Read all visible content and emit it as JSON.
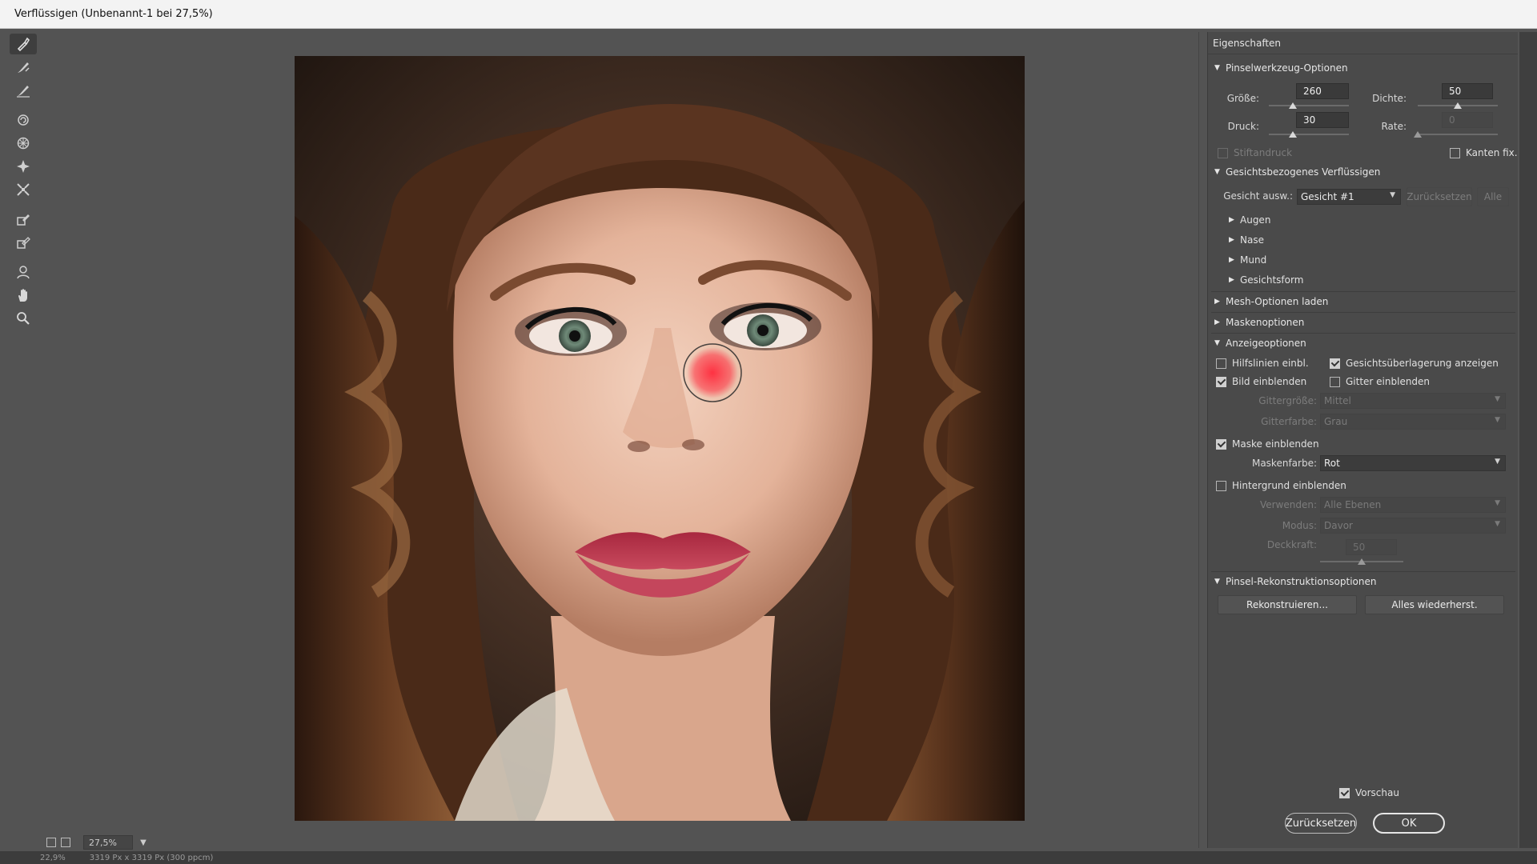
{
  "window": {
    "title": "Verflüssigen (Unbenannt-1 bei 27,5%)"
  },
  "toolbar": {
    "tools": [
      "forward-warp",
      "reconstruct",
      "smooth",
      "twirl",
      "pucker",
      "bloat",
      "push-left",
      "freeze-mask",
      "thaw-mask",
      "face",
      "hand",
      "zoom"
    ]
  },
  "canvas": {
    "zoom": "27,5%",
    "status_zoom": "22,9%",
    "status_doc": "3319 Px x 3319 Px (300 ppcm)"
  },
  "panel": {
    "title": "Eigenschaften",
    "brush": {
      "header": "Pinselwerkzeug-Optionen",
      "size_label": "Größe:",
      "size_value": "260",
      "size_pct": 0.3,
      "density_label": "Dichte:",
      "density_value": "50",
      "density_pct": 0.5,
      "pressure_label": "Druck:",
      "pressure_value": "30",
      "pressure_pct": 0.3,
      "rate_label": "Rate:",
      "rate_value": "0",
      "rate_pct": 0.0,
      "stylus_label": "Stiftandruck",
      "edges_label": "Kanten fix."
    },
    "face": {
      "header": "Gesichtsbezogenes Verflüssigen",
      "select_label": "Gesicht ausw.:",
      "select_value": "Gesicht #1",
      "reset_label": "Zurücksetzen",
      "all_label": "Alle",
      "items": [
        "Augen",
        "Nase",
        "Mund",
        "Gesichtsform"
      ]
    },
    "mesh": {
      "header": "Mesh-Optionen laden"
    },
    "mask": {
      "header": "Maskenoptionen"
    },
    "view": {
      "header": "Anzeigeoptionen",
      "guides_label": "Hilfslinien einbl.",
      "overlay_label": "Gesichtsüberlagerung anzeigen",
      "image_label": "Bild einblenden",
      "mesh_label": "Gitter einblenden",
      "mesh_size_label": "Gittergröße:",
      "mesh_size_value": "Mittel",
      "mesh_color_label": "Gitterfarbe:",
      "mesh_color_value": "Grau",
      "show_mask_label": "Maske einblenden",
      "mask_color_label": "Maskenfarbe:",
      "mask_color_value": "Rot",
      "backdrop_label": "Hintergrund einblenden",
      "use_label": "Verwenden:",
      "use_value": "Alle Ebenen",
      "mode_label": "Modus:",
      "mode_value": "Davor",
      "opacity_label": "Deckkraft:",
      "opacity_value": "50",
      "opacity_pct": 0.5
    },
    "recon": {
      "header": "Pinsel-Rekonstruktionsoptionen",
      "reconstruct_label": "Rekonstruieren...",
      "restore_label": "Alles wiederherst."
    },
    "preview_label": "Vorschau",
    "reset_button": "Zurücksetzen",
    "ok_button": "OK"
  },
  "colors": {
    "panel_bg": "#4a4a4a",
    "canvas_bg": "#535353",
    "mask_red": "#ff2a3c"
  }
}
